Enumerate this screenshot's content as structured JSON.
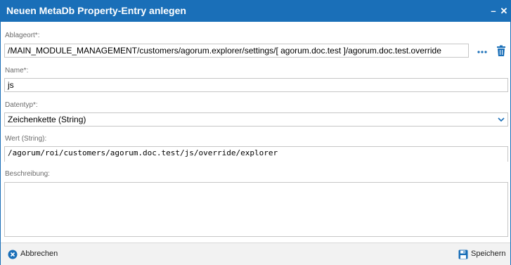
{
  "dialog": {
    "title": "Neuen MetaDb Property-Entry anlegen",
    "minimize_glyph": "–",
    "close_glyph": "✕"
  },
  "fields": {
    "ablageort": {
      "label": "Ablageort*:",
      "value": "/MAIN_MODULE_MANAGEMENT/customers/agorum.explorer/settings/[ agorum.doc.test ]/agorum.doc.test.override"
    },
    "name": {
      "label": "Name*:",
      "value": "js"
    },
    "datentyp": {
      "label": "Datentyp*:",
      "value": "Zeichenkette (String)"
    },
    "wert": {
      "label": "Wert (String):",
      "value": "/agorum/roi/customers/agorum.doc.test/js/override/explorer"
    },
    "beschreibung": {
      "label": "Beschreibung:",
      "value": ""
    }
  },
  "footer": {
    "cancel_label": "Abbrechen",
    "save_label": "Speichern"
  },
  "icons": {
    "more": "more-dots-icon",
    "delete": "trash-icon",
    "dropdown": "chevron-down-icon",
    "cancel": "cancel-circle-icon",
    "save": "save-disk-icon"
  },
  "colors": {
    "accent": "#1a6fb8",
    "footer_bg": "#f2f2f2",
    "label": "#6b6b6b"
  }
}
